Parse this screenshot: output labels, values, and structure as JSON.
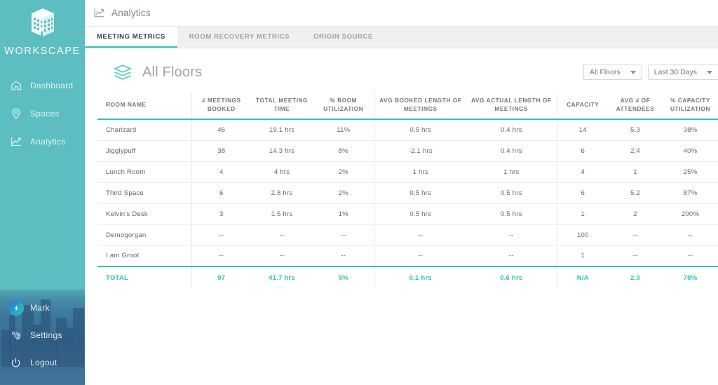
{
  "brand": {
    "name": "WORKSCAPE",
    "logo_icon": "building-icon"
  },
  "sidebar": {
    "top_items": [
      {
        "label": "Dashboard",
        "icon": "home-icon"
      },
      {
        "label": "Spaces",
        "icon": "map-pin-icon"
      },
      {
        "label": "Analytics",
        "icon": "chart-line-icon"
      }
    ],
    "bottom_items": [
      {
        "label": "Mark",
        "icon": "avatar-bolt-icon"
      },
      {
        "label": "Settings",
        "icon": "gear-icon"
      },
      {
        "label": "Logout",
        "icon": "power-icon"
      }
    ]
  },
  "topbar": {
    "title": "Analytics",
    "icon": "chart-line-icon"
  },
  "tabs": [
    {
      "label": "MEETING METRICS",
      "active": true
    },
    {
      "label": "ROOM RECOVERY METRICS",
      "active": false
    },
    {
      "label": "ORIGIN SOURCE",
      "active": false
    }
  ],
  "page": {
    "title": "All Floors",
    "icon": "layers-icon",
    "filters": [
      {
        "name": "floor-filter",
        "value": "All Floors"
      },
      {
        "name": "date-range-filter",
        "value": "Last 30 Days"
      }
    ]
  },
  "colors": {
    "sidebar_teal": "#5cbec0",
    "accent_teal": "#2ec4b6",
    "tab_active_text": "#2c3e50",
    "body_text": "#61696f"
  },
  "table": {
    "columns": [
      "ROOM NAME",
      "# MEETINGS BOOKED",
      "TOTAL MEETING TIME",
      "% ROOM UTILIZATION",
      "AVG BOOKED LENGTH OF MEETINGS",
      "AVG ACTUAL LENGTH OF MEETINGS",
      "CAPACITY",
      "AVG # OF ATTENDEES",
      "% CAPACITY UTILIZATION"
    ],
    "rows": [
      {
        "cells": [
          "Charizard",
          "46",
          "19.1 hrs",
          "11%",
          "0.5 hrs",
          "0.4 hrs",
          "14",
          "5.3",
          "38%"
        ]
      },
      {
        "cells": [
          "Jigglypuff",
          "38",
          "14.3 hrs",
          "8%",
          "-2.1 hrs",
          "0.4 hrs",
          "6",
          "2.4",
          "40%"
        ]
      },
      {
        "cells": [
          "Lunch Room",
          "4",
          "4 hrs",
          "2%",
          "1 hrs",
          "1 hrs",
          "4",
          "1",
          "25%"
        ]
      },
      {
        "cells": [
          "Third Space",
          "6",
          "2.8 hrs",
          "2%",
          "0.5 hrs",
          "0.5 hrs",
          "6",
          "5.2",
          "87%"
        ]
      },
      {
        "cells": [
          "Kelvin's Desk",
          "3",
          "1.5 hrs",
          "1%",
          "0.5 hrs",
          "0.5 hrs",
          "1",
          "2",
          "200%"
        ]
      },
      {
        "cells": [
          "Demogorgan",
          "--",
          "--",
          "--",
          "--",
          "--",
          "100",
          "--",
          "--"
        ]
      },
      {
        "cells": [
          "I am Groot",
          "--",
          "--",
          "--",
          "--",
          "--",
          "1",
          "--",
          "--"
        ]
      }
    ],
    "total_row": {
      "cells": [
        "TOTAL",
        "97",
        "41.7 hrs",
        "5%",
        "0.1 hrs",
        "0.6 hrs",
        "N/A",
        "2.3",
        "78%"
      ]
    }
  }
}
